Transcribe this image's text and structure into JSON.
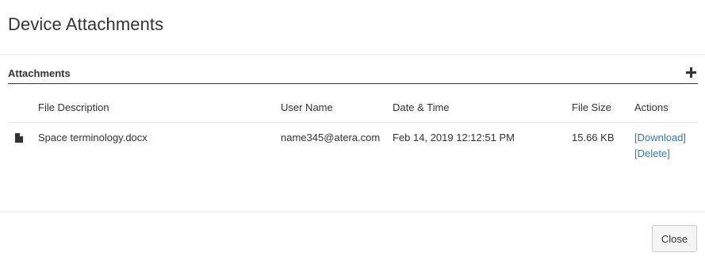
{
  "modal": {
    "title": "Device Attachments"
  },
  "section": {
    "title": "Attachments",
    "add_icon": "plus-icon"
  },
  "table": {
    "columns": {
      "description": "File Description",
      "user": "User Name",
      "date": "Date & Time",
      "size": "File Size",
      "actions": "Actions"
    },
    "rows": [
      {
        "icon": "file-icon",
        "description": "Space terminology.docx",
        "user": "name345@atera.com",
        "date": "Feb 14, 2019 12:12:51 PM",
        "size": "15.66 KB",
        "download_label": "[Download]",
        "delete_label": "[Delete]"
      }
    ]
  },
  "footer": {
    "close_label": "Close"
  },
  "colors": {
    "link": "#337ab7",
    "text": "#333333",
    "divider": "#eeeeee"
  }
}
